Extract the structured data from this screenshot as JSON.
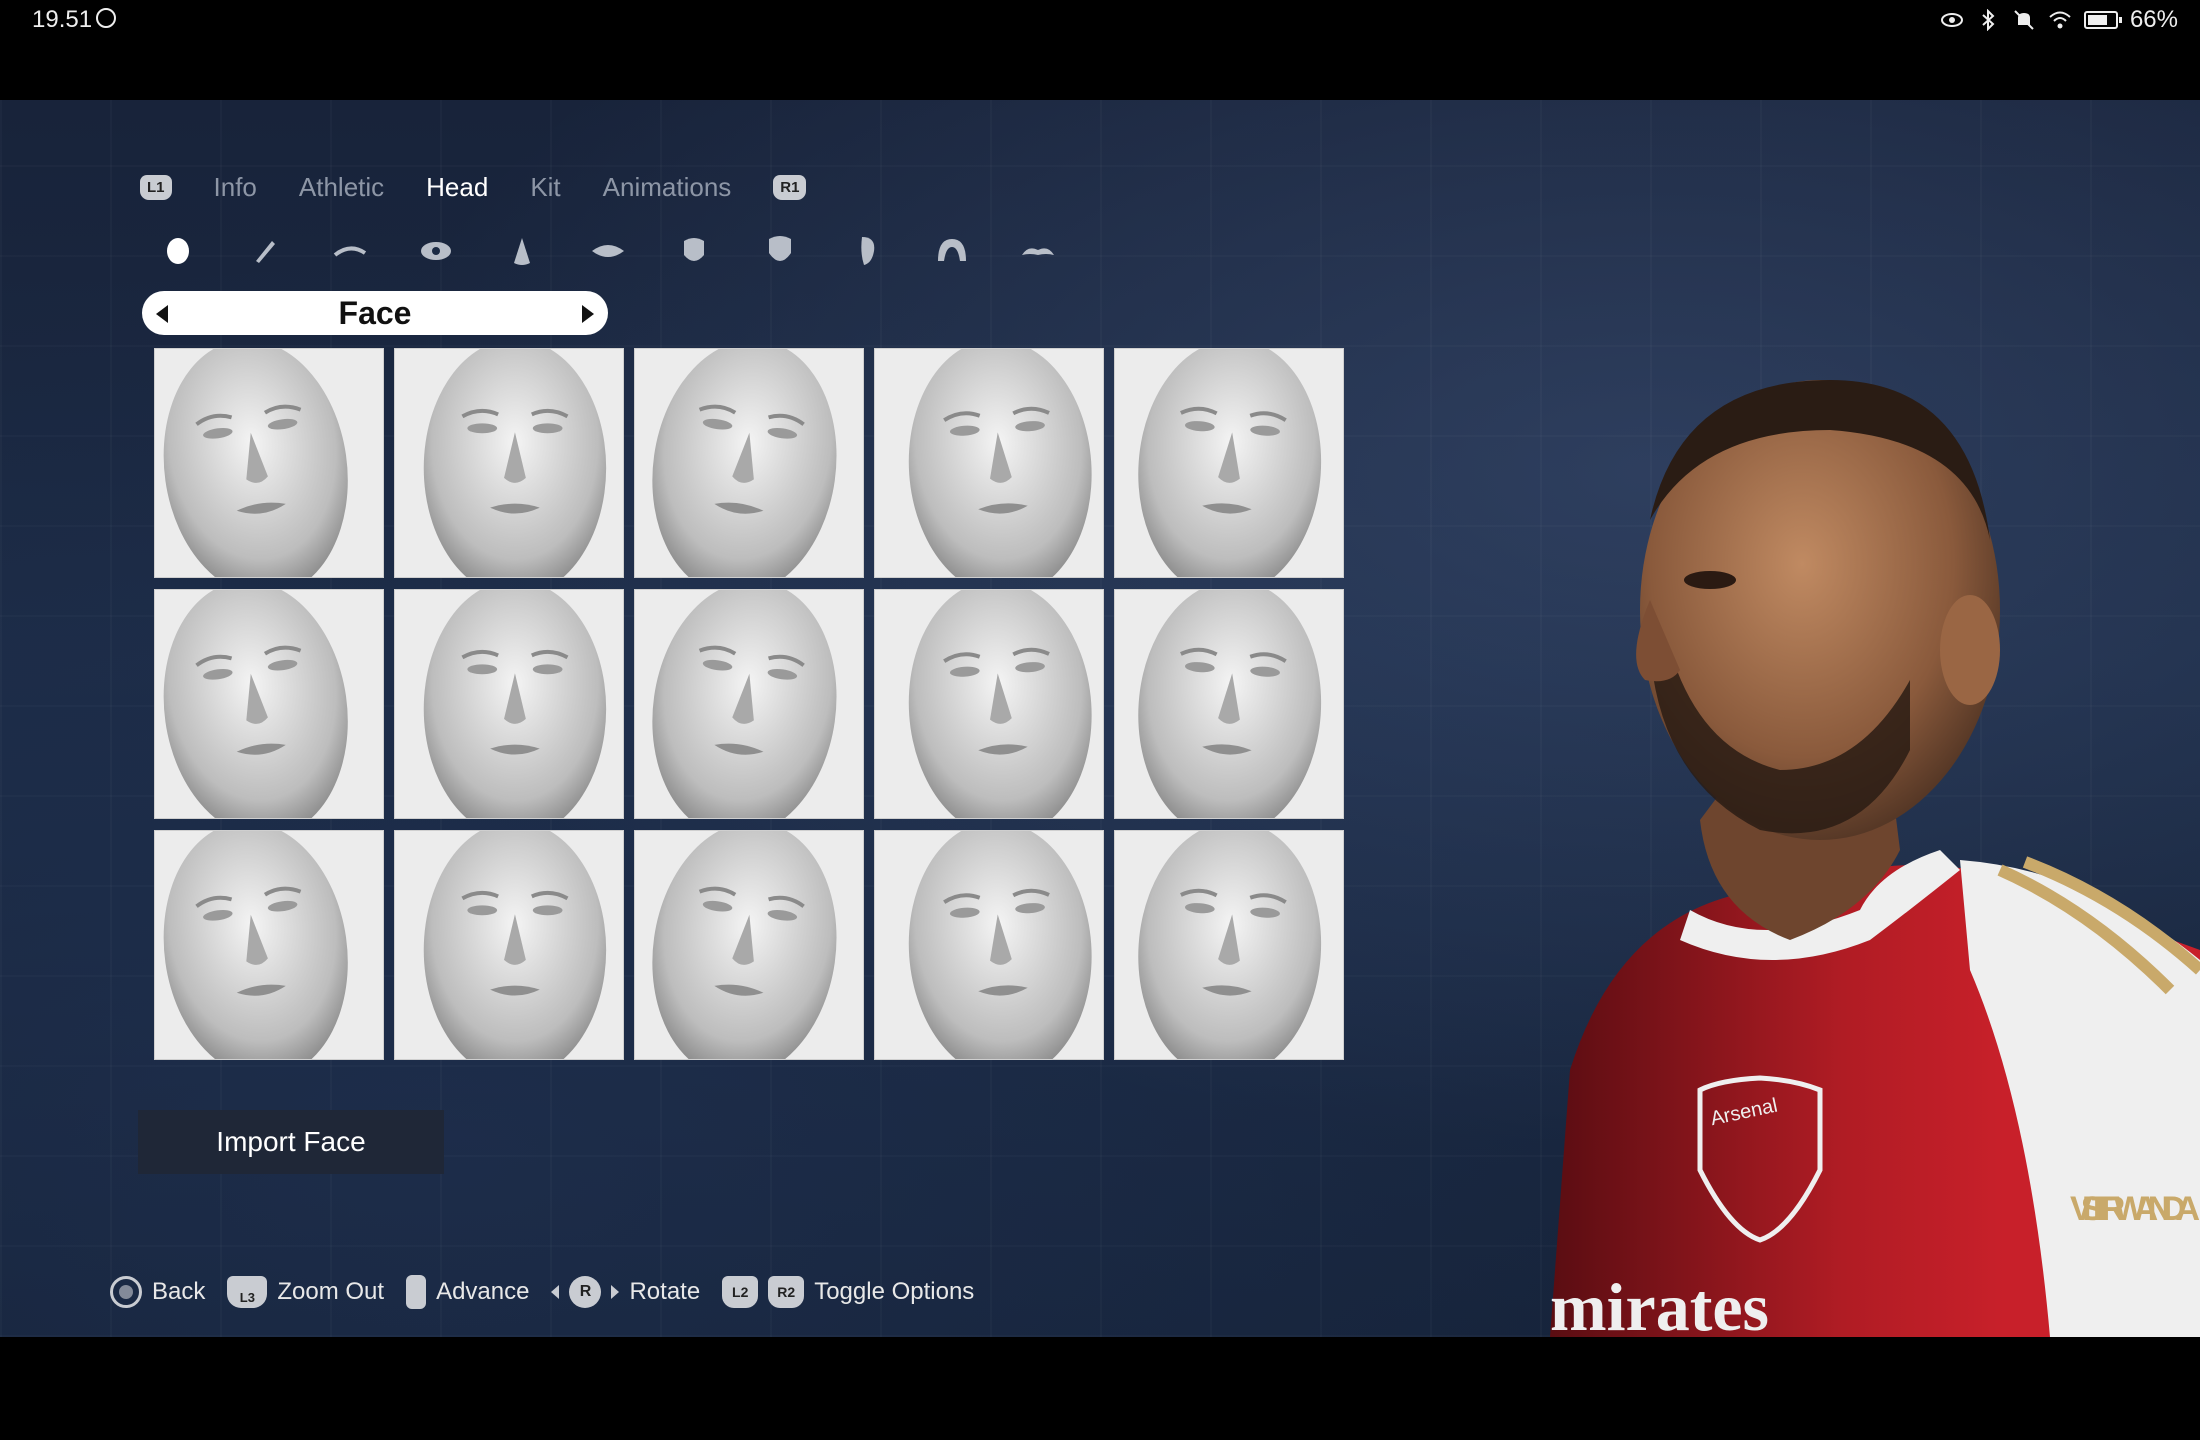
{
  "status_bar": {
    "time": "19.51",
    "battery": "66%",
    "icons": [
      "whatsapp-icon",
      "eye-icon",
      "bluetooth-icon",
      "mute-icon",
      "wifi-icon",
      "battery-icon"
    ]
  },
  "tabs": {
    "left_button": "L1",
    "right_button": "R1",
    "items": [
      {
        "label": "Info"
      },
      {
        "label": "Athletic"
      },
      {
        "label": "Head"
      },
      {
        "label": "Kit"
      },
      {
        "label": "Animations"
      }
    ],
    "active": "Head"
  },
  "categories": [
    "face-icon",
    "brush-icon",
    "eyebrow-icon",
    "eye-icon",
    "nose-icon",
    "lips-icon",
    "jaw-icon",
    "chin-icon",
    "ear-icon",
    "hair-icon",
    "moustache-icon"
  ],
  "selector": {
    "label": "Face"
  },
  "faces": {
    "count": 15,
    "selected_index": 0
  },
  "import_button": {
    "label": "Import Face"
  },
  "hints": {
    "back": "Back",
    "zoom_out_button": "L3",
    "zoom_out": "Zoom Out",
    "advance": "Advance",
    "rotate_button": "R",
    "rotate": "Rotate",
    "toggle_l2": "L2",
    "toggle_r2": "R2",
    "toggle_options": "Toggle Options"
  },
  "player": {
    "kit_colors": {
      "red": "#c8202a",
      "white": "#f2f2f2",
      "gold": "#c9a96a"
    },
    "sponsor_text": "mirates",
    "badge_text": "Arsenal",
    "sleeve_text": "VISIT RWANDA"
  }
}
